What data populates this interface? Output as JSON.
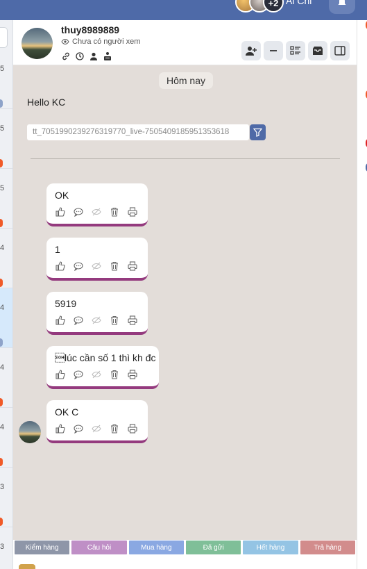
{
  "topbar": {
    "avatar_overflow": "+2",
    "agent_name": "Ai Chi"
  },
  "left_list": {
    "counts": [
      "5",
      "5",
      "5",
      "4",
      "4",
      "4",
      "4",
      "3",
      "3"
    ]
  },
  "chat_header": {
    "username": "thuy8989889",
    "seen_status": "Chưa có người xem"
  },
  "chat": {
    "date_label": "Hôm nay",
    "greeting": "Hello KC",
    "source_id": "tt_7051990239276319770_live-7505409185951353618",
    "messages": [
      {
        "text": "OK"
      },
      {
        "text": "1"
      },
      {
        "text": "5919"
      },
      {
        "text": "\u0001lúc cần số 1 thì kh đc"
      },
      {
        "text": "OK C"
      }
    ]
  },
  "tags": [
    {
      "label": "Kiểm hàng",
      "color": "#8e96a8"
    },
    {
      "label": "Câu hỏi",
      "color": "#bf8fc6"
    },
    {
      "label": "Mua hàng",
      "color": "#8aa8e2"
    },
    {
      "label": "Đã gửi",
      "color": "#7fbf98"
    },
    {
      "label": "Hết hàng",
      "color": "#94c4e4"
    },
    {
      "label": "Trả hàng",
      "color": "#d28c8c"
    }
  ],
  "colors": {
    "topbar": "#4e6aa8",
    "chat_background": "#e3ddd9",
    "message_accent": "#943a7e"
  }
}
